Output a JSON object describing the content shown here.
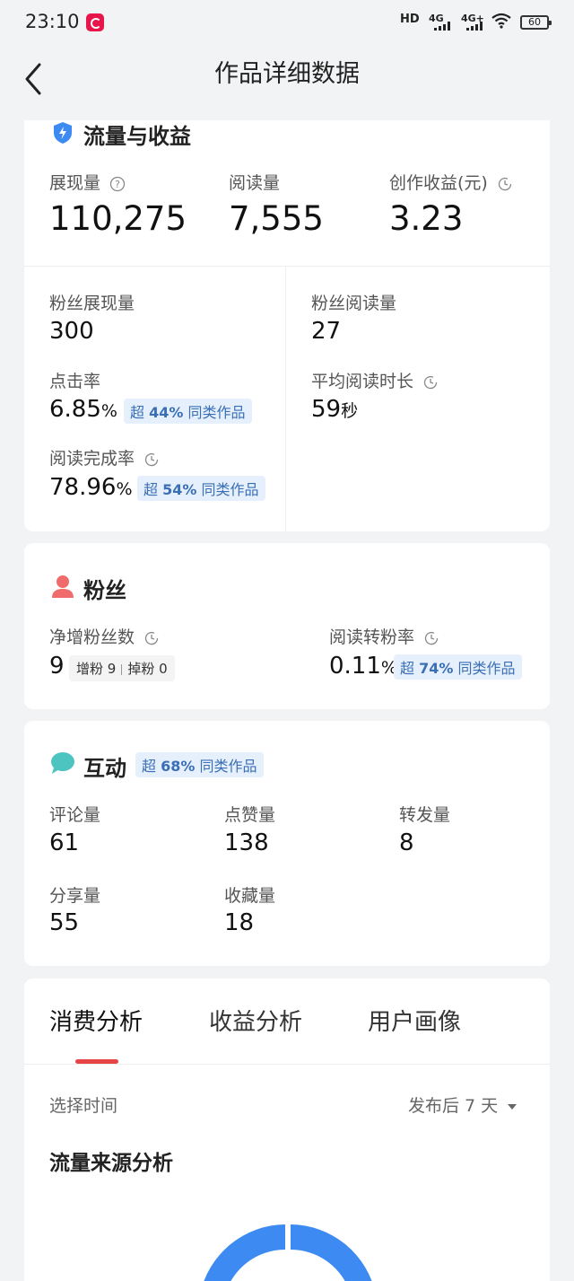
{
  "status_bar": {
    "time": "23:10",
    "hd": "HD",
    "sim1": "4G",
    "sim2": "4G+",
    "battery": "60"
  },
  "header": {
    "title": "作品详细数据"
  },
  "traffic": {
    "title": "流量与收益",
    "impressions_label": "展现量",
    "impressions_value": "110,275",
    "reads_label": "阅读量",
    "reads_value": "7,555",
    "earnings_label": "创作收益(元)",
    "earnings_value": "3.23",
    "fan_impressions_label": "粉丝展现量",
    "fan_impressions_value": "300",
    "fan_reads_label": "粉丝阅读量",
    "fan_reads_value": "27",
    "ctr_label": "点击率",
    "ctr_value": "6.85",
    "ctr_unit": "%",
    "ctr_badge_prefix": "超",
    "ctr_badge_pct": "44%",
    "ctr_badge_suffix": "同类作品",
    "avg_read_label": "平均阅读时长",
    "avg_read_value": "59",
    "avg_read_unit": "秒",
    "completion_label": "阅读完成率",
    "completion_value": "78.96",
    "completion_unit": "%",
    "completion_badge_prefix": "超",
    "completion_badge_pct": "54%",
    "completion_badge_suffix": "同类作品"
  },
  "fans": {
    "title": "粉丝",
    "net_label": "净增粉丝数",
    "net_value": "9",
    "gain_label": "增粉",
    "gain_value": "9",
    "loss_label": "掉粉",
    "loss_value": "0",
    "conv_label": "阅读转粉率",
    "conv_value": "0.11",
    "conv_unit": "%",
    "conv_badge_prefix": "超",
    "conv_badge_pct": "74%",
    "conv_badge_suffix": "同类作品"
  },
  "interaction": {
    "title": "互动",
    "badge_prefix": "超",
    "badge_pct": "68%",
    "badge_suffix": "同类作品",
    "comments_label": "评论量",
    "comments_value": "61",
    "likes_label": "点赞量",
    "likes_value": "138",
    "forwards_label": "转发量",
    "forwards_value": "8",
    "shares_label": "分享量",
    "shares_value": "55",
    "favorites_label": "收藏量",
    "favorites_value": "18"
  },
  "analysis": {
    "tabs": [
      "消费分析",
      "收益分析",
      "用户画像"
    ],
    "time_label": "选择时间",
    "time_value": "发布后 7 天",
    "section_title": "流量来源分析"
  },
  "colors": {
    "accent_blue": "#3d8bf2",
    "tab_indicator": "#e64545",
    "badge_bg": "#e6f0fd",
    "fan_icon": "#f06b6b",
    "chat_icon": "#4cc4c0"
  }
}
